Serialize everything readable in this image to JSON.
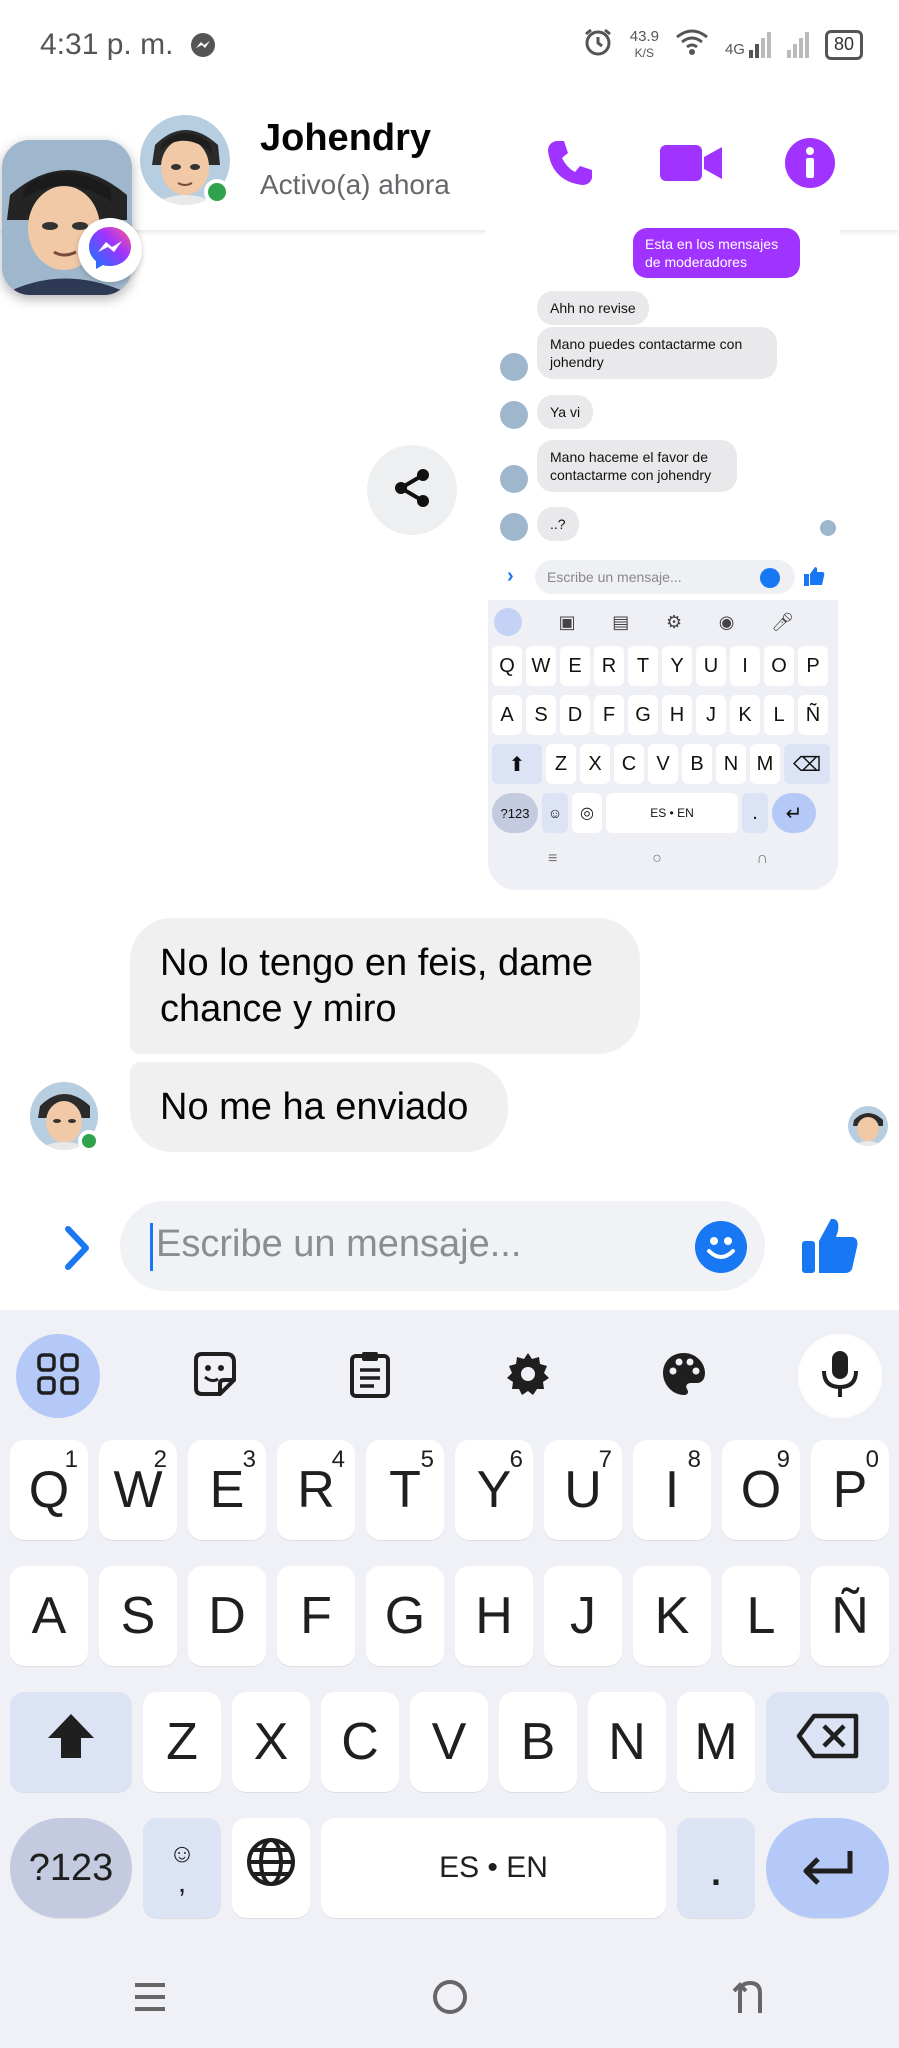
{
  "status_bar": {
    "time": "4:31 p. m.",
    "net_speed_value": "43.9",
    "net_speed_unit": "K/S",
    "network": "4G",
    "battery": "80"
  },
  "header": {
    "contact_name": "Johendry",
    "presence": "Activo(a) ahora"
  },
  "colors": {
    "accent_purple": "#a033ff",
    "messenger_blue": "#1877f2",
    "online_green": "#31a24c"
  },
  "shared_image": {
    "my_message": "Esta en los mensajes de moderadores",
    "messages": [
      "Ahh no revise",
      "Mano puedes contactarme con johendry",
      "Ya vi",
      "Mano haceme el favor de contactarme con johendry",
      "..?"
    ],
    "input_placeholder": "Escribe un mensaje...",
    "keys_row1": [
      "Q",
      "W",
      "E",
      "R",
      "T",
      "Y",
      "U",
      "I",
      "O",
      "P"
    ],
    "keys_row2": [
      "A",
      "S",
      "D",
      "F",
      "G",
      "H",
      "J",
      "K",
      "L",
      "Ñ"
    ],
    "keys_row3": [
      "Z",
      "X",
      "C",
      "V",
      "B",
      "N",
      "M"
    ],
    "sym_key": "?123",
    "space_label": "ES • EN",
    "period": "."
  },
  "messages": [
    {
      "text": "No lo tengo en feis, dame chance y miro"
    },
    {
      "text": "No me ha enviado"
    }
  ],
  "composer": {
    "placeholder": "Escribe un mensaje..."
  },
  "keyboard": {
    "row1": [
      "Q",
      "W",
      "E",
      "R",
      "T",
      "Y",
      "U",
      "I",
      "O",
      "P"
    ],
    "row1_hints": [
      "1",
      "2",
      "3",
      "4",
      "5",
      "6",
      "7",
      "8",
      "9",
      "0"
    ],
    "row2": [
      "A",
      "S",
      "D",
      "F",
      "G",
      "H",
      "J",
      "K",
      "L",
      "Ñ"
    ],
    "row3": [
      "Z",
      "X",
      "C",
      "V",
      "B",
      "N",
      "M"
    ],
    "sym_key": "?123",
    "comma_key": ",",
    "space_label": "ES • EN",
    "period_key": "."
  }
}
